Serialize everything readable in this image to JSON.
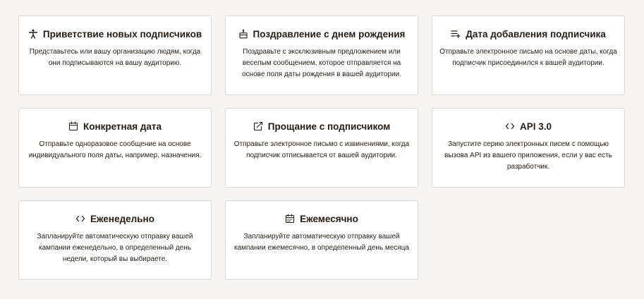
{
  "cards": [
    {
      "icon": "person-welcome-icon",
      "title": "Приветствие новых подписчиков",
      "description": "Представьтесь или вашу организацию людям, когда они подписываются на вашу аудиторию."
    },
    {
      "icon": "birthday-cake-icon",
      "title": "Поздравление с днем рождения",
      "description": "Поздравьте с эксклюзивным предложением или веселым сообщением, которое отправляется на основе поля даты рождения в вашей аудитории."
    },
    {
      "icon": "list-add-icon",
      "title": "Дата добавления подписчика",
      "description": "Отправьте электронное письмо на основе даты, когда подписчик присоединился к вашей аудитории."
    },
    {
      "icon": "calendar-icon",
      "title": "Конкретная дата",
      "description": "Отправьте одноразовое сообщение на основе индивидуального поля даты, например, назначения."
    },
    {
      "icon": "external-link-icon",
      "title": "Прощание с подписчиком",
      "description": "Отправьте электронное письмо с извинениями, когда подписчик отписывается от вашей аудитории."
    },
    {
      "icon": "code-brackets-icon",
      "title": "API 3.0",
      "description": "Запустите серию электронных писем с помощью вызова API из вашего приложения, если у вас есть разработчик."
    },
    {
      "icon": "code-brackets-icon",
      "title": "Еженедельно",
      "description": "Запланируйте автоматическую отправку вашей кампании еженедельно, в определенный день недели, который вы выбираете."
    },
    {
      "icon": "calendar-month-icon",
      "title": "Ежемесячно",
      "description": "Запланируйте автоматическую отправку вашей кампании ежемесячно, в определенный день месяца"
    }
  ]
}
